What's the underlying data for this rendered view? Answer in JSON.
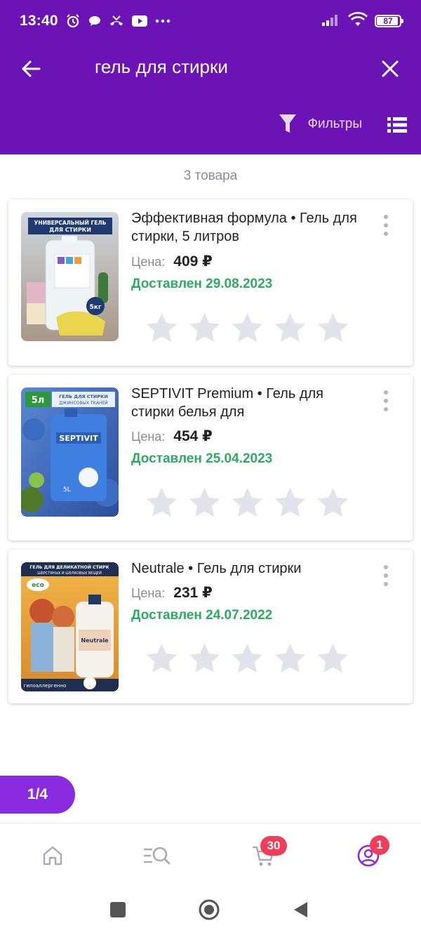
{
  "status_bar": {
    "time": "13:40",
    "battery": "87",
    "battery_level": 0.87
  },
  "header": {
    "search_query": "гель для стирки",
    "filters_label": "Фильтры"
  },
  "results": {
    "count_text": "3 товара"
  },
  "products": [
    {
      "title": "Эффективная формула • Гель для стирки, 5 литров",
      "price_label": "Цена:",
      "price": "409 ₽",
      "delivered": "Доставлен 29.08.2023",
      "image_banner": "УНИВЕРСАЛЬНЫЙ ГЕЛЬ ДЛЯ СТИРКИ",
      "image_badge": "5кг",
      "rating": 0
    },
    {
      "title": "SEPTIVIT Premium • Гель для стирки белья для",
      "price_label": "Цена:",
      "price": "454 ₽",
      "delivered": "Доставлен 25.04.2023",
      "image_badge": "5л",
      "image_banner": "ГЕЛЬ ДЛЯ СТИРКИ ДЖИНСОВЫХ ТКАНЕЙ",
      "image_brand": "SEPTIVIT",
      "rating": 0
    },
    {
      "title": "Neutrale • Гель для стирки",
      "price_label": "Цена:",
      "price": "231 ₽",
      "delivered": "Доставлен 24.07.2022",
      "image_banner": "ГЕЛЬ ДЛЯ ДЕЛИКАТНОЙ СТИРК",
      "image_subbanner": "ШЕРСТЯНЫХ И ШЕЛКОВЫХ ВЕЩЕЙ",
      "image_brand": "Neutrale",
      "image_footer": "гипоаллергенно",
      "rating": 0
    }
  ],
  "pagination": {
    "label": "1/4"
  },
  "bottom_nav": {
    "cart_badge": "30",
    "profile_badge": "1"
  },
  "colors": {
    "brand": "#6b13b5",
    "accent": "#8a2be2",
    "delivered": "#2eaa62",
    "star": "#e3e3ec",
    "badge": "#f03e5a"
  }
}
